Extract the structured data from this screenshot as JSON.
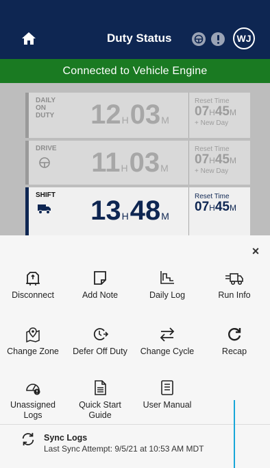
{
  "header": {
    "title": "Duty Status",
    "avatar_initials": "WJ",
    "home_icon": "home-icon",
    "icons": [
      "steering-status-icon",
      "alert-icon"
    ]
  },
  "banner": {
    "text": "Connected to Vehicle Engine",
    "color": "#1a7a22"
  },
  "clocks": [
    {
      "label": [
        "DAILY",
        "ON",
        "DUTY"
      ],
      "hours": "12",
      "minutes": "03",
      "hour_unit": "H",
      "minute_unit": "M",
      "reset_label": "Reset Time",
      "reset_hours": "07",
      "reset_minutes": "45",
      "reset_hour_unit": "H",
      "reset_minute_unit": "M",
      "reset_note": "+ New Day"
    },
    {
      "label": [
        "DRIVE"
      ],
      "hours": "11",
      "minutes": "03",
      "hour_unit": "H",
      "minute_unit": "M",
      "reset_label": "Reset Time",
      "reset_hours": "07",
      "reset_minutes": "45",
      "reset_hour_unit": "H",
      "reset_minute_unit": "M",
      "reset_note": "+ New Day"
    },
    {
      "label": [
        "SHIFT"
      ],
      "hours": "13",
      "minutes": "48",
      "hour_unit": "H",
      "minute_unit": "M",
      "reset_label": "Reset Time",
      "reset_hours": "07",
      "reset_minutes": "45",
      "reset_hour_unit": "H",
      "reset_minute_unit": "M",
      "reset_note": ""
    }
  ],
  "drawer": {
    "close_label": "×",
    "items": [
      {
        "label": "Disconnect",
        "icon": "disconnect-icon"
      },
      {
        "label": "Add Note",
        "icon": "note-icon"
      },
      {
        "label": "Daily Log",
        "icon": "daily-log-icon"
      },
      {
        "label": "Run Info",
        "icon": "truck-icon"
      },
      {
        "label": "Change Zone",
        "icon": "map-pin-icon"
      },
      {
        "label": "Defer Off Duty",
        "icon": "clock-forward-icon"
      },
      {
        "label": "Change Cycle",
        "icon": "swap-arrows-icon"
      },
      {
        "label": "Recap",
        "icon": "refresh-icon"
      },
      {
        "label": "Unassigned Logs",
        "icon": "gauge-icon"
      },
      {
        "label": "Quick Start Guide",
        "icon": "document-icon"
      },
      {
        "label": "User Manual",
        "icon": "manual-icon"
      }
    ],
    "sync": {
      "title": "Sync Logs",
      "subtitle": "Last Sync Attempt: 9/5/21 at 10:53 AM MDT"
    }
  },
  "colors": {
    "header_bg": "#0e2652",
    "banner_bg": "#1a7a22",
    "accent_line": "#17a6d8"
  }
}
